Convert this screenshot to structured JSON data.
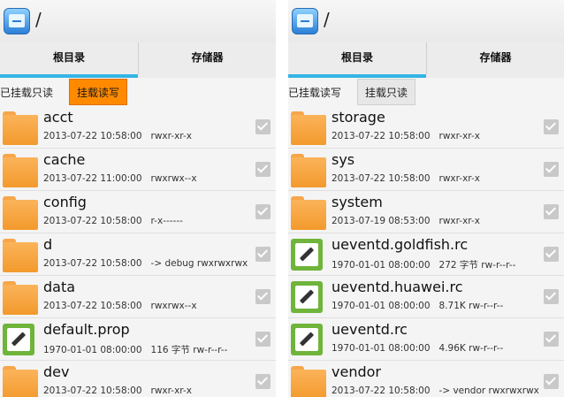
{
  "left": {
    "path": "/",
    "tabs": [
      "根目录",
      "存储器"
    ],
    "mode_label": "已挂载只读",
    "mode_button": "挂载读写",
    "entries": [
      {
        "name": "acct",
        "date": "2013-07-22 10:58:00",
        "perm": "rwxr-xr-x",
        "type": "folder"
      },
      {
        "name": "cache",
        "date": "2013-07-22 11:00:00",
        "perm": "rwxrwx--x",
        "type": "folder"
      },
      {
        "name": "config",
        "date": "2013-07-22 10:58:00",
        "perm": "r-x------",
        "type": "folder"
      },
      {
        "name": "d",
        "date": "2013-07-22 10:58:00",
        "perm": "-> debug  rwxrwxrwx",
        "type": "folder"
      },
      {
        "name": "data",
        "date": "2013-07-22 10:58:00",
        "perm": "rwxrwx--x",
        "type": "folder"
      },
      {
        "name": "default.prop",
        "date": "1970-01-01 08:00:00",
        "perm": "116 字节   rw-r--r--",
        "type": "file"
      },
      {
        "name": "dev",
        "date": "2013-07-22 10:58:00",
        "perm": "rwxr-xr-x",
        "type": "folder"
      }
    ]
  },
  "right": {
    "path": "/",
    "tabs": [
      "根目录",
      "存储器"
    ],
    "mode_label": "已挂载读写",
    "mode_button": "挂载只读",
    "entries": [
      {
        "name": "storage",
        "date": "2013-07-22 10:58:00",
        "perm": "rwxr-xr-x",
        "type": "folder"
      },
      {
        "name": "sys",
        "date": "2013-07-22 10:58:00",
        "perm": "rwxr-xr-x",
        "type": "folder"
      },
      {
        "name": "system",
        "date": "2013-07-19 08:53:00",
        "perm": "rwxr-xr-x",
        "type": "folder"
      },
      {
        "name": "ueventd.goldfish.rc",
        "date": "1970-01-01 08:00:00",
        "perm": "272 字节   rw-r--r--",
        "type": "file"
      },
      {
        "name": "ueventd.huawei.rc",
        "date": "1970-01-01 08:00:00",
        "perm": "8.71K   rw-r--r--",
        "type": "file"
      },
      {
        "name": "ueventd.rc",
        "date": "1970-01-01 08:00:00",
        "perm": "4.96K   rw-r--r--",
        "type": "file"
      },
      {
        "name": "vendor",
        "date": "2013-07-22 10:58:00",
        "perm": "-> vendor  rwxrwxrwx",
        "type": "folder"
      }
    ]
  },
  "colors": {
    "accent": "#33b5e5",
    "active_button": "#ff8a00",
    "folder": "#f7a64a",
    "file_icon": "#6fb43b"
  }
}
